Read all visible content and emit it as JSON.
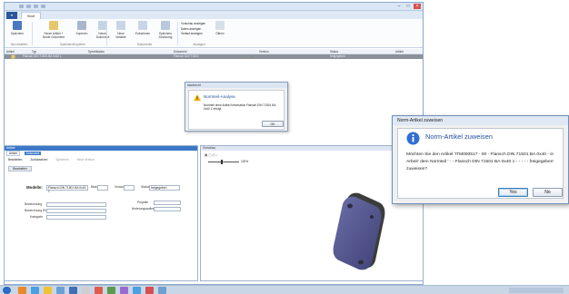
{
  "app": {
    "tabs": [
      "Start"
    ],
    "quick_access": [
      "save",
      "undo",
      "redo",
      "separator",
      "customize"
    ]
  },
  "ribbon": {
    "buttons": [
      {
        "label": "Speichern",
        "icon": "save-icon"
      },
      {
        "label": "Neuer Artikel +\nNeuer Dokument",
        "icon": "new-article-icon"
      },
      {
        "label": "Kopieren",
        "icon": "copy-icon"
      },
      {
        "label": "Neues Dokument",
        "icon": "new-document-icon"
      },
      {
        "label": "Neue Variante",
        "icon": "new-variant-icon"
      },
      {
        "label": "Entnahmen",
        "icon": "withdraw-icon"
      },
      {
        "label": "Speichern\nZeichnung",
        "icon": "save-drawing-icon"
      },
      {
        "label": "Öffnen",
        "icon": "open-icon"
      }
    ],
    "small_buttons": [
      "Vorschau anzeigen",
      "Daten anzeigen",
      "Verlauf anzeigen"
    ],
    "groups": [
      "Neu erstellen",
      "Speichern/Kopieren",
      "Dokumente",
      "Anzeigen"
    ]
  },
  "grid": {
    "columns": [
      "Artikel",
      "Typ",
      "Spezifikation",
      "Dokument",
      "Version",
      "Status",
      "Artikel"
    ],
    "row": {
      "name": "Flansch DIN 71501 BA 0x40 1",
      "doc": "Flansch DIN 71501",
      "status": "freigegeben"
    }
  },
  "msg_dialog": {
    "title": "Nachricht",
    "heading": "Normteil-Analyse",
    "text": "Normteil ohne Artikel Information Flansch DIN 71501 BA 0x40 1 erfolgt",
    "ok": "OK"
  },
  "left_pane": {
    "title": "Artikel",
    "tabs": [
      "Artikel",
      "Dokument"
    ],
    "toolbar": [
      "Bearbeiten",
      "Zurücksetzen",
      "Speichern",
      "Neue Version"
    ],
    "action": "Bearbeiten",
    "field_label": "Modelle:",
    "field_value": "Flansch DIN 71501 BA 0x40 1",
    "small_labels": [
      "Blatt",
      "Version",
      "Status"
    ],
    "status_value": "freigegeben",
    "labels": [
      "Bezeichnung",
      "Bezeichnung EN",
      "Kategorie"
    ],
    "right_labels": [
      "Projekte",
      "Änderungsauftrag"
    ]
  },
  "right_pane": {
    "title": "Vorschau",
    "zoom": "100%"
  },
  "norm_dialog": {
    "window_title": "Norm-Artikel zuweisen",
    "heading": "Norm-Artikel zuweisen",
    "text": "Möchten Sie den Artikel 'ITM000517 - 00 - Flansch DIN 71501 BA 0x40 - in Arbeit' dem Normteil ' - - Flansch DIN 71501 BA 0x40 1 - - - - - freigegeben' zuweisen?",
    "yes": "Yes",
    "no": "No"
  },
  "colors": {
    "accent": "#2b579a",
    "selection_row": "#8c9098",
    "part_face": "#4d4f86",
    "info_icon": "#2f6fd0",
    "warning_icon": "#f2b500"
  }
}
